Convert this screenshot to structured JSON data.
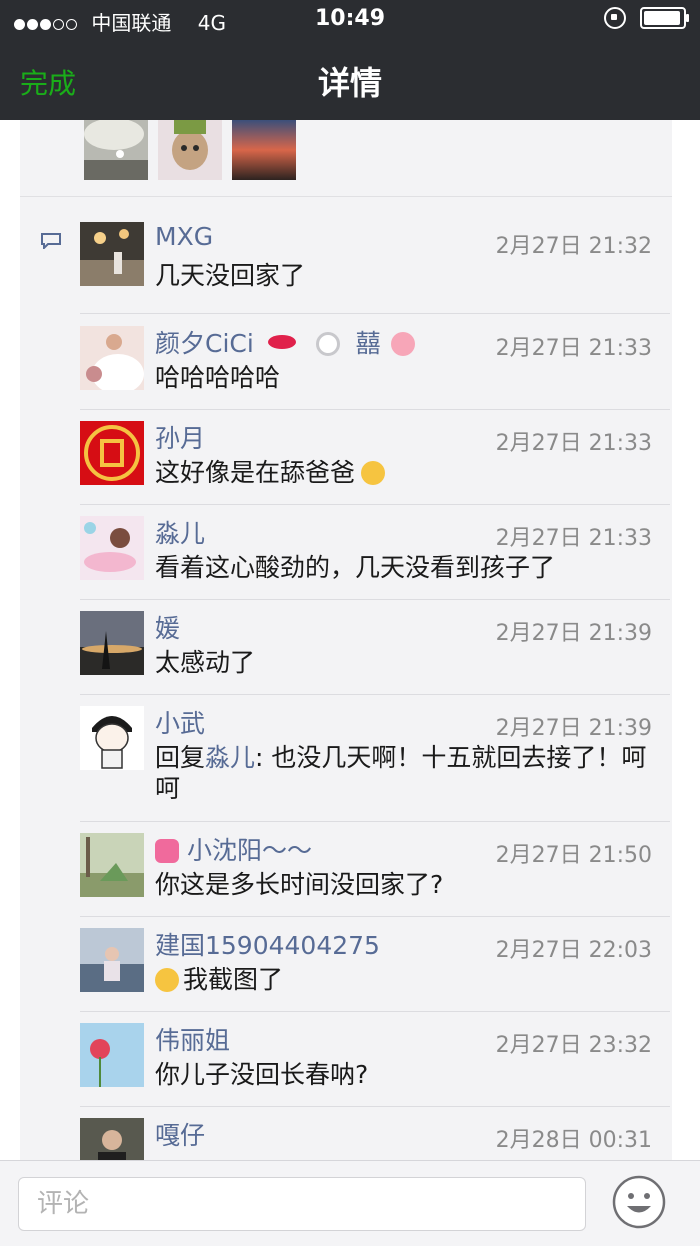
{
  "status_bar": {
    "carrier": "中国联通",
    "network": "4G",
    "time": "10:49"
  },
  "nav": {
    "done": "完成",
    "title": "详情"
  },
  "comments": [
    {
      "name": "MXG",
      "time": "2月27日 21:32",
      "text": "几天没回家了"
    },
    {
      "name": "颜夕CiCi",
      "name_suffix": "囍",
      "time": "2月27日 21:33",
      "text": "哈哈哈哈哈"
    },
    {
      "name": "孙月",
      "time": "2月27日 21:33",
      "text": "这好像是在舔爸爸"
    },
    {
      "name": "淼儿",
      "time": "2月27日 21:33",
      "text": "看着这心酸劲的，几天没看到孩子了"
    },
    {
      "name": "媛",
      "time": "2月27日 21:39",
      "text": "太感动了"
    },
    {
      "name": "小武",
      "time": "2月27日 21:39",
      "reply_prefix": "回复",
      "reply_to": "淼儿",
      "text": ": 也没几天啊！十五就回去接了！呵呵"
    },
    {
      "name": "小沈阳～～",
      "time": "2月27日 21:50",
      "text": "你这是多长时间没回家了?"
    },
    {
      "name": "建国15904404275",
      "time": "2月27日 22:03",
      "text": "我截图了"
    },
    {
      "name": "伟丽姐",
      "time": "2月27日 23:32",
      "text": "你儿子没回长春呐?"
    },
    {
      "name": "嘎仔",
      "time": "2月28日 00:31",
      "text": ""
    }
  ],
  "input": {
    "placeholder": "评论"
  },
  "icons": {
    "comment": "comment-bubble-icon",
    "emoji": "smiley-face-icon"
  },
  "colors": {
    "link": "#576b95",
    "accent": "#1aad19",
    "nav_bg": "#2b2d31"
  }
}
